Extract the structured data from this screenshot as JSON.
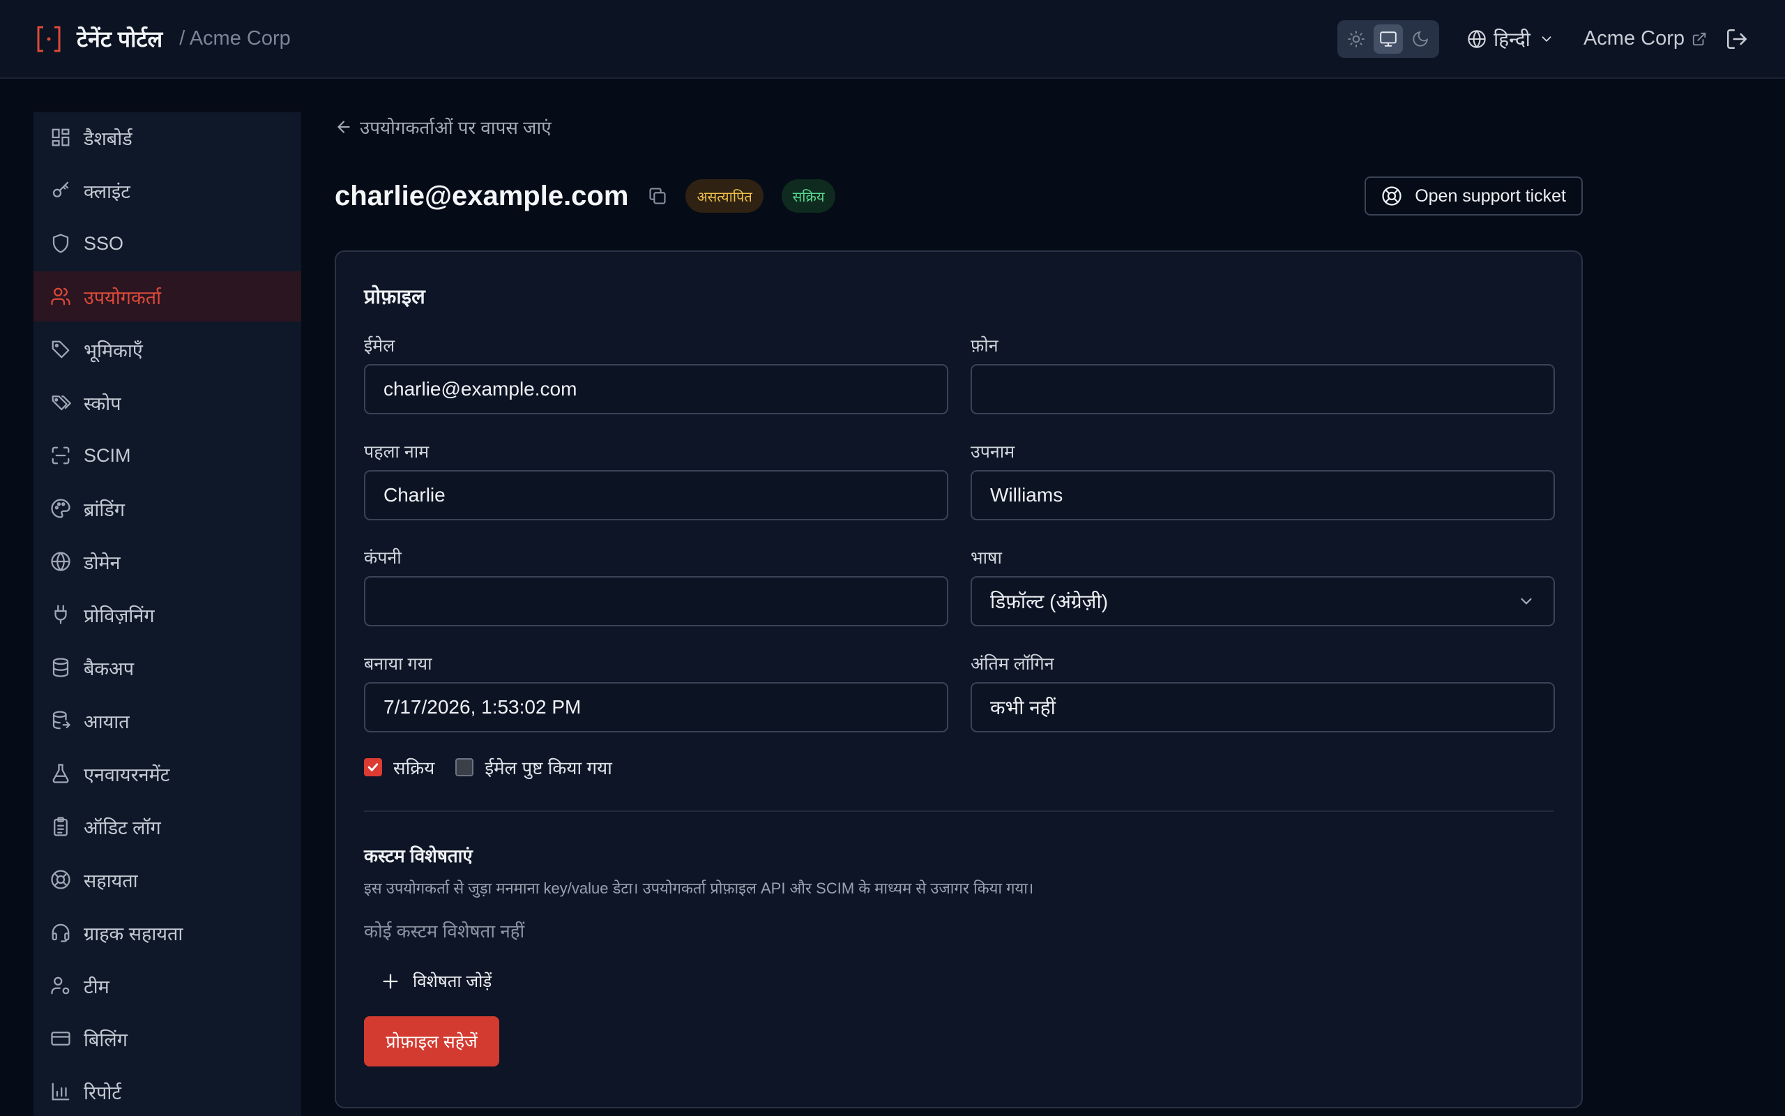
{
  "topbar": {
    "brand_title": "टेनेंट पोर्टल",
    "brand_org": "/ Acme Corp",
    "language": "हिन्दी",
    "org_link": "Acme Corp"
  },
  "sidebar": {
    "items": [
      {
        "label": "डैशबोर्ड",
        "icon": "dashboard-icon"
      },
      {
        "label": "क्लाइंट",
        "icon": "key-icon"
      },
      {
        "label": "SSO",
        "icon": "shield-icon"
      },
      {
        "label": "उपयोगकर्ता",
        "icon": "users-icon",
        "active": true
      },
      {
        "label": "भूमिकाएँ",
        "icon": "tag-icon"
      },
      {
        "label": "स्कोप",
        "icon": "tags-icon"
      },
      {
        "label": "SCIM",
        "icon": "scan-icon"
      },
      {
        "label": "ब्रांडिंग",
        "icon": "palette-icon"
      },
      {
        "label": "डोमेन",
        "icon": "globe-icon"
      },
      {
        "label": "प्रोविज़निंग",
        "icon": "plug-icon"
      },
      {
        "label": "बैकअप",
        "icon": "database-icon"
      },
      {
        "label": "आयात",
        "icon": "database-import-icon"
      },
      {
        "label": "एनवायरनमेंट",
        "icon": "flask-icon"
      },
      {
        "label": "ऑडिट लॉग",
        "icon": "clipboard-icon"
      },
      {
        "label": "सहायता",
        "icon": "lifebuoy-icon"
      },
      {
        "label": "ग्राहक सहायता",
        "icon": "headset-icon"
      },
      {
        "label": "टीम",
        "icon": "user-cog-icon"
      },
      {
        "label": "बिलिंग",
        "icon": "credit-card-icon"
      },
      {
        "label": "रिपोर्ट",
        "icon": "bar-chart-icon"
      }
    ]
  },
  "main": {
    "back_label": "उपयोगकर्ताओं पर वापस जाएं",
    "user_email": "charlie@example.com",
    "badge_unverified": "असत्यापित",
    "badge_active": "सक्रिय",
    "support_button": "Open support ticket"
  },
  "profile": {
    "title": "प्रोफ़ाइल",
    "email_label": "ईमेल",
    "email_value": "charlie@example.com",
    "phone_label": "फ़ोन",
    "phone_value": "",
    "first_name_label": "पहला नाम",
    "first_name_value": "Charlie",
    "last_name_label": "उपनाम",
    "last_name_value": "Williams",
    "company_label": "कंपनी",
    "company_value": "",
    "language_label": "भाषा",
    "language_value": "डिफ़ॉल्ट (अंग्रेज़ी)",
    "created_label": "बनाया गया",
    "created_value": "7/17/2026, 1:53:02 PM",
    "last_login_label": "अंतिम लॉगिन",
    "last_login_value": "कभी नहीं",
    "active_checkbox": "सक्रिय",
    "active_checked": true,
    "email_verified_checkbox": "ईमेल पुष्ट किया गया",
    "email_verified_checked": false,
    "custom_title": "कस्टम विशेषताएं",
    "custom_desc": "इस उपयोगकर्ता से जुड़ा मनमाना key/value डेटा। उपयोगकर्ता प्रोफ़ाइल API और SCIM के माध्यम से उजागर किया गया।",
    "no_custom": "कोई कस्टम विशेषता नहीं",
    "add_attribute": "विशेषता जोड़ें",
    "save_button": "प्रोफ़ाइल सहेजें"
  },
  "colors": {
    "accent": "#dc4a3a",
    "background": "#050b17",
    "badge_unverified": "#f0c14a",
    "badge_active": "#58d68d"
  }
}
